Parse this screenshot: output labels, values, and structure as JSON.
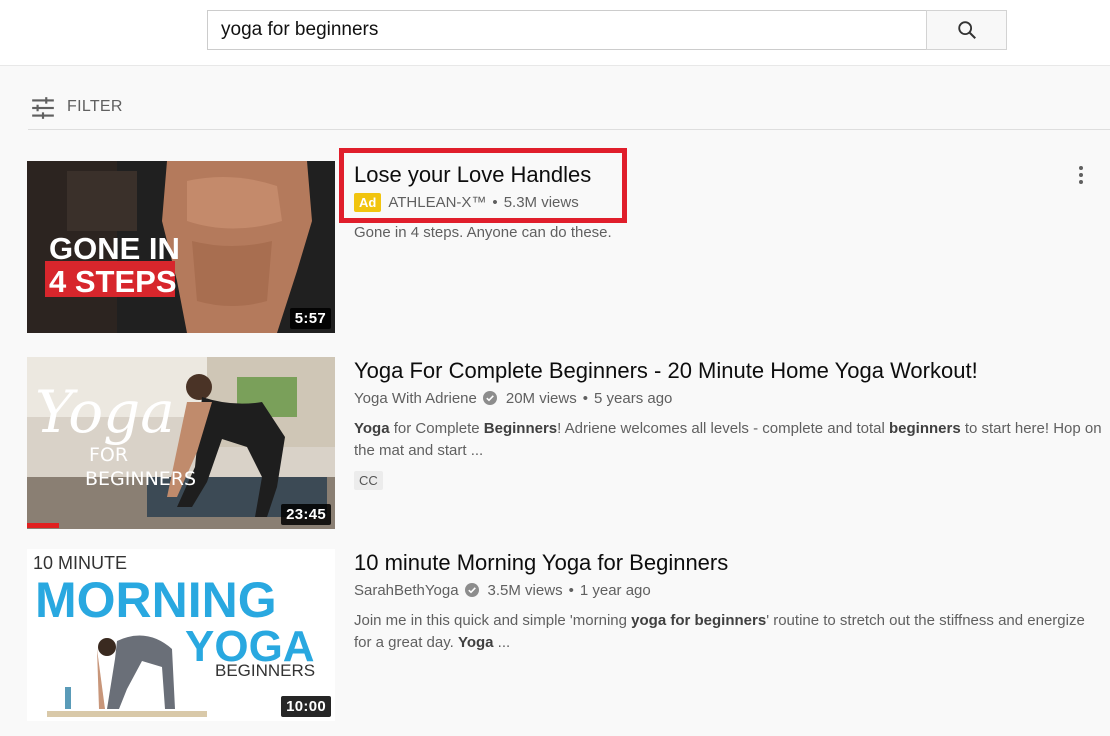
{
  "search": {
    "query": "yoga for beginners"
  },
  "filter": {
    "label": "FILTER"
  },
  "results": [
    {
      "title": "Lose your Love Handles",
      "ad_badge": "Ad",
      "channel": "ATHLEAN-X™",
      "views": "5.3M views",
      "description": "Gone in 4 steps. Anyone can do these.",
      "duration": "5:57",
      "thumb_text_1": "GONE IN",
      "thumb_text_2": "4 STEPS"
    },
    {
      "title": "Yoga For Complete Beginners - 20 Minute Home Yoga Workout!",
      "channel": "Yoga With Adriene",
      "views": "20M views",
      "age": "5 years ago",
      "desc_parts": [
        "Yoga",
        " for Complete ",
        "Beginners",
        "! Adriene welcomes all levels - complete and total ",
        "beginners",
        " to start here! Hop on the mat and start ..."
      ],
      "badge": "CC",
      "duration": "23:45",
      "thumb_text_1": "Yoga",
      "thumb_text_2": "FOR",
      "thumb_text_3": "BEGINNERS"
    },
    {
      "title": "10 minute Morning Yoga for Beginners",
      "channel": "SarahBethYoga",
      "views": "3.5M views",
      "age": "1 year ago",
      "desc_parts": [
        "Join me in this quick and simple 'morning ",
        "yoga for beginners",
        "' routine to stretch out the stiffness and energize for a great day. ",
        "Yoga",
        " ..."
      ],
      "duration": "10:00",
      "thumb_text_1": "10 MINUTE",
      "thumb_text_2": "MORNING",
      "thumb_text_3": "YOGA",
      "thumb_text_4": "BEGINNERS"
    }
  ],
  "colors": {
    "ad_badge": "#f1c40f",
    "highlight": "#e01e2b",
    "meta": "#606060"
  },
  "icons": [
    "search-icon",
    "filter-icon",
    "verified-icon",
    "more-icon"
  ]
}
